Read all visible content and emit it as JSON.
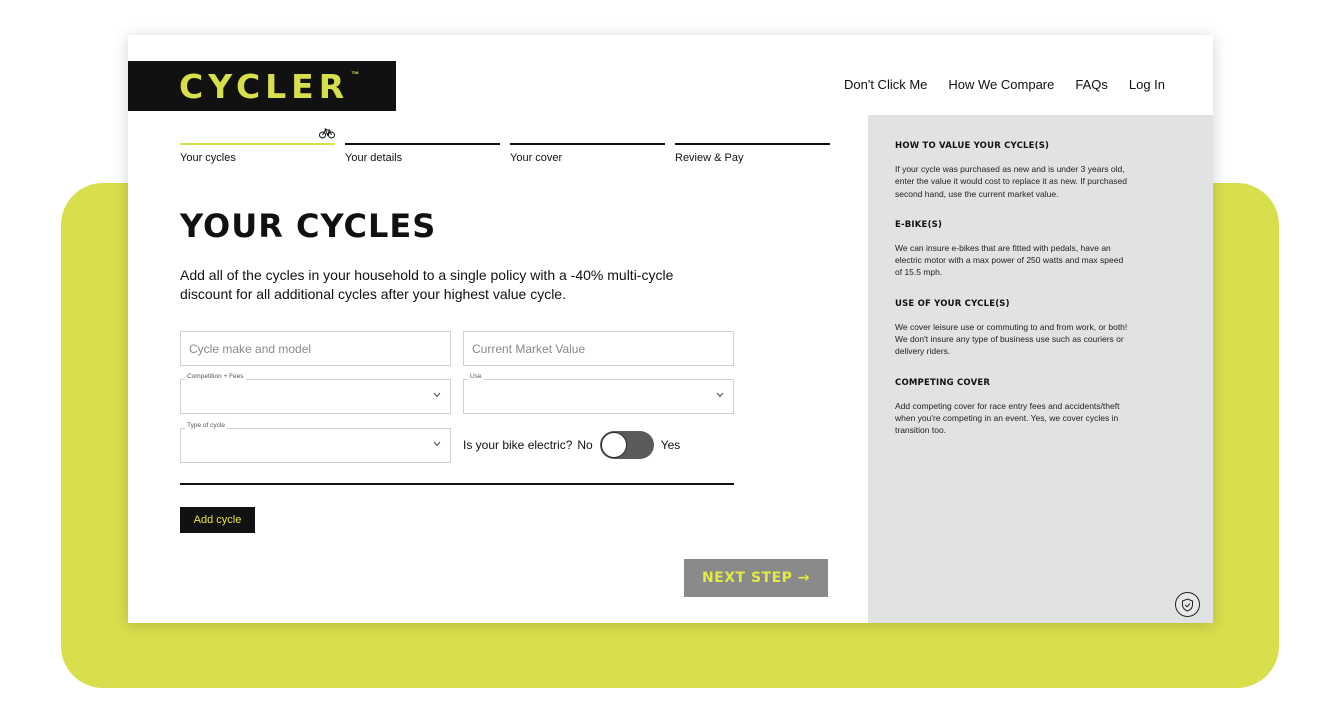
{
  "brand": {
    "name": "CYCLER",
    "tm": "™",
    "accent": "#d8df4c",
    "dark": "#111111"
  },
  "nav": {
    "items": [
      "Don't Click Me",
      "How We Compare",
      "FAQs",
      "Log In"
    ]
  },
  "steps": [
    {
      "label": "Your cycles",
      "active": true,
      "icon": "bicycle-icon"
    },
    {
      "label": "Your details",
      "active": false
    },
    {
      "label": "Your cover",
      "active": false
    },
    {
      "label": "Review & Pay",
      "active": false
    }
  ],
  "main": {
    "title": "YOUR CYCLES",
    "intro": "Add all of the cycles in your household to a single policy with a -40% multi-cycle discount for all additional cycles after your highest value cycle."
  },
  "form": {
    "make_model": {
      "placeholder": "Cycle make and model",
      "value": ""
    },
    "market_value": {
      "placeholder": "Current Market Value",
      "value": ""
    },
    "competition": {
      "label": "Competition + Fees",
      "value": ""
    },
    "use": {
      "label": "Use",
      "value": ""
    },
    "type": {
      "label": "Type of cycle",
      "value": ""
    },
    "electric": {
      "question": "Is your bike electric?",
      "no": "No",
      "yes": "Yes",
      "on": false
    }
  },
  "buttons": {
    "add": "Add cycle",
    "next": "NEXT STEP →"
  },
  "sidebar": {
    "sections": [
      {
        "heading": "HOW TO VALUE YOUR CYCLE(S)",
        "text": "If your cycle was purchased as new and is under 3 years old, enter the value it would cost to replace it as new. If purchased second hand, use the current market value."
      },
      {
        "heading": "E-BIKE(S)",
        "text": "We can insure e-bikes that are fitted with pedals, have an electric motor with a max power of 250 watts and max speed of 15.5 mph."
      },
      {
        "heading": "USE OF YOUR CYCLE(S)",
        "text": "We cover leisure use or commuting to and from work, or both! We don't insure any type of business use such as couriers or delivery riders."
      },
      {
        "heading": "COMPETING COVER",
        "text": "Add competing cover for race entry fees and accidents/theft when you're competing in an event. Yes, we cover cycles in transition too."
      }
    ],
    "badge_icon": "shield-check-icon"
  }
}
